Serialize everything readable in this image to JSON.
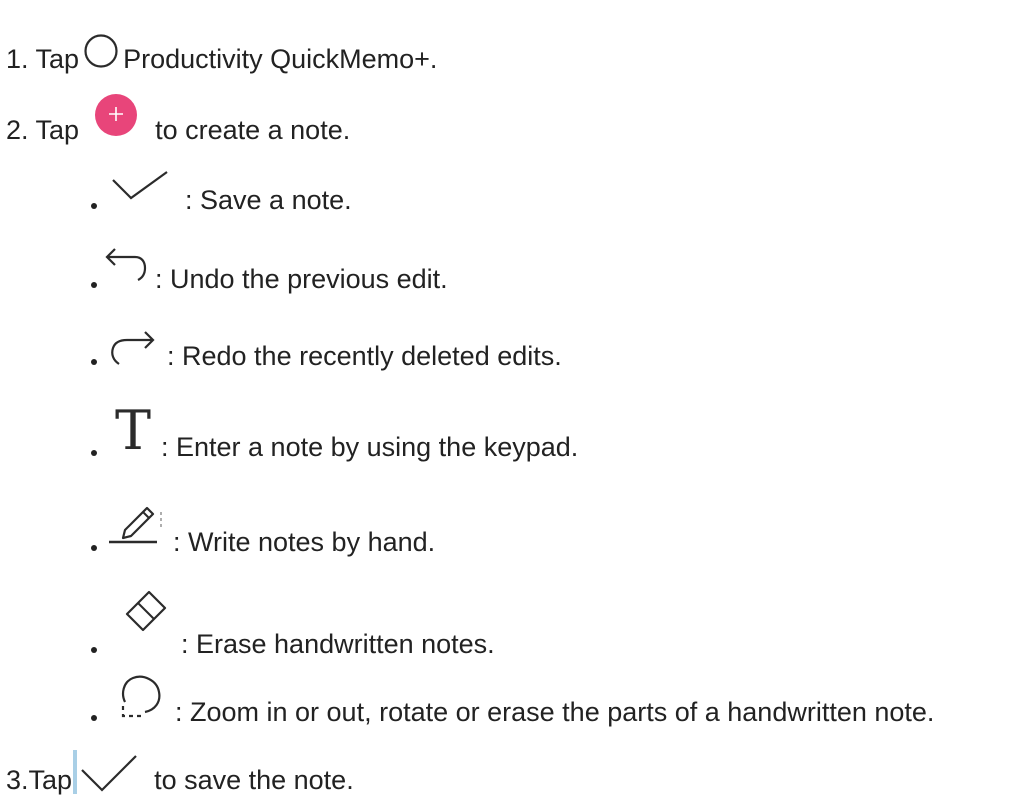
{
  "steps": [
    {
      "number": "1. Tap",
      "icon": "home-circle-icon",
      "text": "Productivity QuickMemo+."
    },
    {
      "number": "2. Tap",
      "icon": "add-note-fab-icon",
      "text": "to create a note."
    },
    {
      "number": "3.Tap",
      "icon": "checkmark-icon",
      "text": "to save the note."
    }
  ],
  "bullets": [
    {
      "icon": "checkmark-icon",
      "text": ": Save a note."
    },
    {
      "icon": "undo-icon",
      "text": ": Undo the previous edit."
    },
    {
      "icon": "redo-icon",
      "text": ": Redo the recently deleted edits."
    },
    {
      "icon": "text-mode-icon",
      "text": ": Enter a note by using the keypad."
    },
    {
      "icon": "pen-icon",
      "text": ": Write notes by hand."
    },
    {
      "icon": "eraser-icon",
      "text": ": Erase handwritten notes."
    },
    {
      "icon": "lasso-select-icon",
      "text": ": Zoom in or out, rotate or erase the parts of a handwritten note."
    }
  ],
  "colors": {
    "fab": "#e8457a",
    "text": "#222222",
    "icon_stroke": "#2b2b2b",
    "accent_bar": "#a9cfe6"
  }
}
